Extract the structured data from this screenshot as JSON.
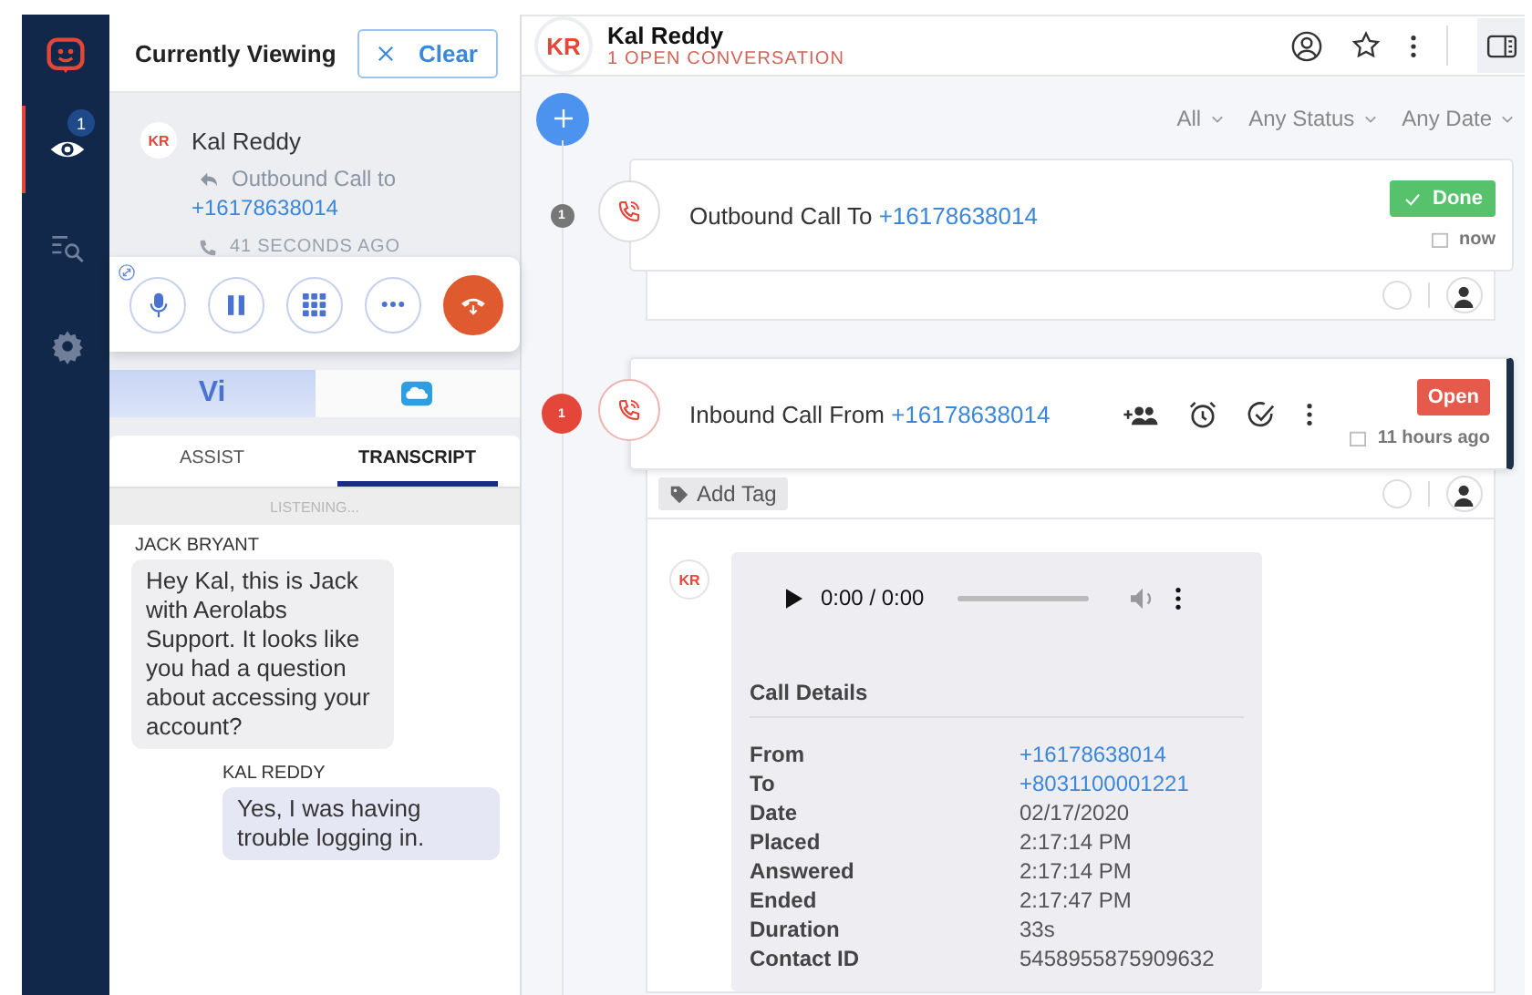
{
  "nav_items": [
    {
      "kind": "viewing",
      "selected": true,
      "badge": "1"
    },
    {
      "kind": "search",
      "selected": false
    },
    {
      "kind": "settings",
      "selected": false
    }
  ],
  "viewing_panel": {
    "title": "Currently Viewing",
    "clear_button": "Clear",
    "contact": {
      "initials": "KR",
      "name": "Kal Reddy",
      "activity": "Outbound Call to",
      "phone": "+16178638014",
      "time": "41 SECONDS AGO"
    }
  },
  "app_tabs": [
    {
      "kind": "text",
      "label": "Vi",
      "selected": true
    },
    {
      "kind": "cloud",
      "selected": false
    }
  ],
  "assist_tabs": [
    {
      "label": "ASSIST",
      "selected": false
    },
    {
      "label": "TRANSCRIPT",
      "selected": true
    }
  ],
  "listening_status": "LISTENING...",
  "transcript": [
    {
      "speaker": "JACK BRYANT",
      "kind": "agent",
      "text": "Hey Kal, this is Jack with Aerolabs Support. It looks like you had a question about accessing your account?"
    },
    {
      "speaker": "KAL REDDY",
      "kind": "customer",
      "text": "Yes, I was having trouble logging in."
    }
  ],
  "conversation": {
    "initials": "KR",
    "name": "Kal Reddy",
    "subtitle": "1 OPEN CONVERSATION"
  },
  "filters": [
    "All",
    "Any Status",
    "Any Date"
  ],
  "timeline": [
    {
      "number": "1",
      "title": "Outbound Call To",
      "phone": "+16178638014",
      "status": {
        "kind": "done",
        "label": "Done"
      },
      "time": "now",
      "selected": false,
      "checked": false
    },
    {
      "number": "1",
      "title": "Inbound Call From",
      "phone": "+16178638014",
      "status": {
        "kind": "open",
        "label": "Open"
      },
      "time": "11 hours ago",
      "selected": true,
      "checked": false,
      "add_tag": "Add Tag"
    }
  ],
  "call_details": {
    "initials": "KR",
    "player": {
      "time": "0:00 / 0:00"
    },
    "title": "Call Details",
    "rows": [
      {
        "label": "From",
        "value": "+16178638014",
        "kind": "link"
      },
      {
        "label": "To",
        "value": "+8031100001221",
        "kind": "link"
      },
      {
        "label": "Date",
        "value": "02/17/2020",
        "kind": "text"
      },
      {
        "label": "Placed",
        "value": "2:17:14 PM",
        "kind": "text"
      },
      {
        "label": "Answered",
        "value": "2:17:14 PM",
        "kind": "text"
      },
      {
        "label": "Ended",
        "value": "2:17:47 PM",
        "kind": "text"
      },
      {
        "label": "Duration",
        "value": "33s",
        "kind": "text"
      },
      {
        "label": "Contact ID",
        "value": "5458955875909632",
        "kind": "text"
      }
    ]
  }
}
